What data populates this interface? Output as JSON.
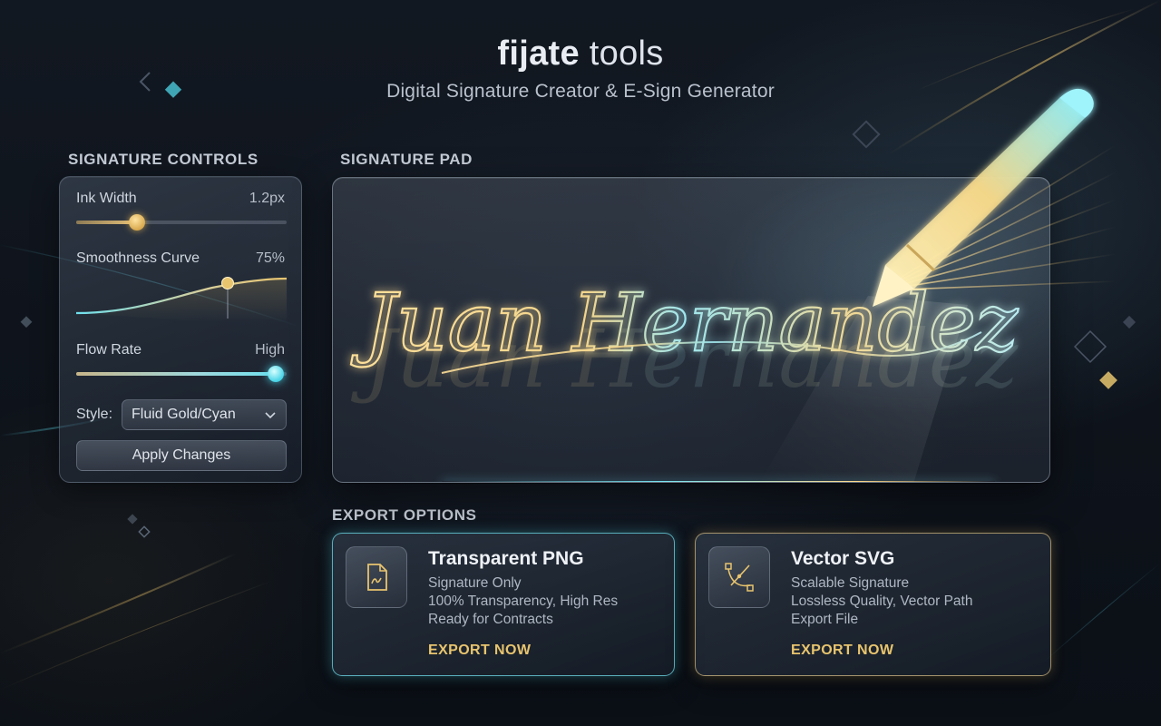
{
  "header": {
    "brand_bold": "fijate",
    "brand_light": "tools",
    "tagline": "Digital Signature Creator & E-Sign Generator"
  },
  "controls": {
    "title": "SIGNATURE CONTROLS",
    "ink_width": {
      "label": "Ink Width",
      "value": "1.2px",
      "level": 0.29
    },
    "smoothness": {
      "label": "Smoothness Curve",
      "value": "75%",
      "level": 0.72
    },
    "flow_rate": {
      "label": "Flow Rate",
      "value": "High",
      "level": 0.95
    },
    "style": {
      "label": "Style:",
      "selected": "Fluid Gold/Cyan"
    },
    "apply_label": "Apply Changes"
  },
  "pad": {
    "title": "SIGNATURE PAD",
    "signature_text": "Juan Hernandez"
  },
  "export": {
    "title": "EXPORT OPTIONS",
    "options": [
      {
        "title": "Transparent PNG",
        "lines": [
          "Signature Only",
          "100% Transparency, High Res",
          "Ready for Contracts"
        ],
        "action": "EXPORT NOW",
        "icon": "image-file-icon"
      },
      {
        "title": "Vector SVG",
        "lines": [
          "Scalable Signature",
          "Lossless Quality, Vector Path",
          "Export File"
        ],
        "action": "EXPORT NOW",
        "icon": "bezier-pen-icon"
      }
    ]
  },
  "colors": {
    "gold": "#e8c46e",
    "cyan": "#6fe0ee",
    "background": "#0f141c"
  }
}
